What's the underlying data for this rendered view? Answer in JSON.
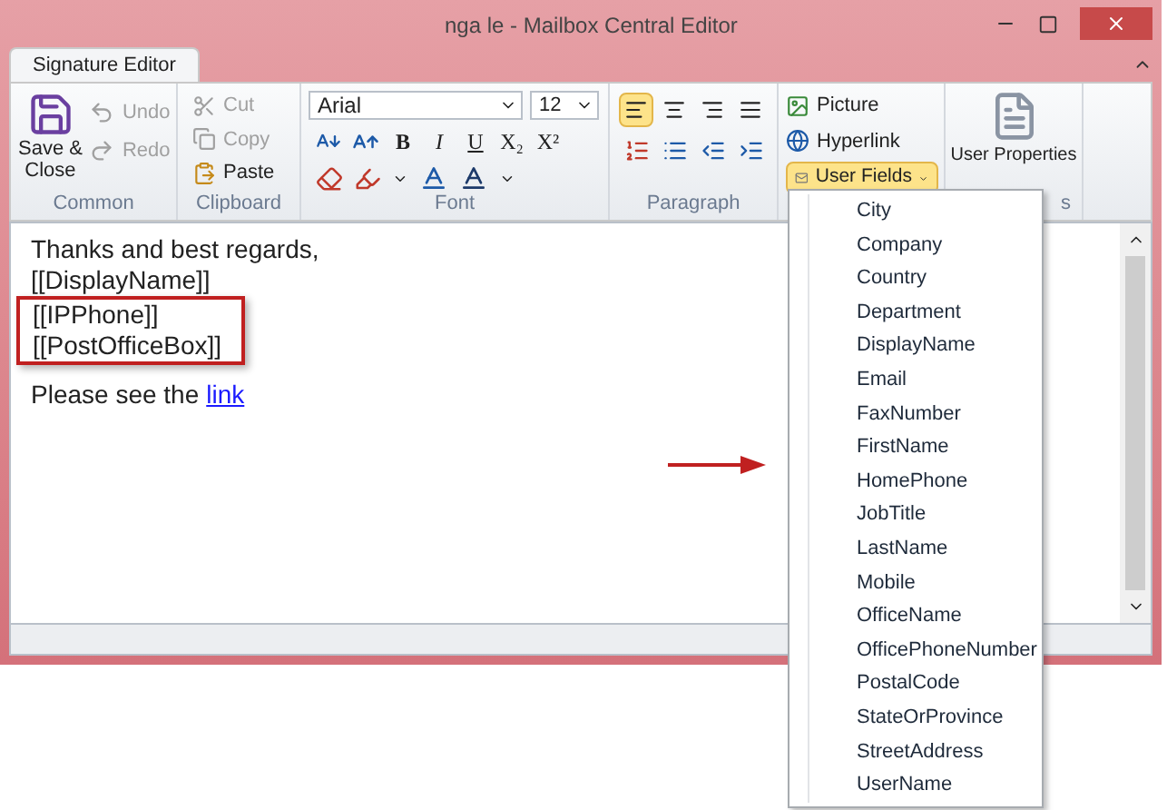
{
  "window": {
    "title": "nga le - Mailbox Central Editor"
  },
  "tabs": [
    {
      "label": "Signature Editor",
      "selected": true
    }
  ],
  "ribbon": {
    "common": {
      "label": "Common",
      "save": "Save &\nClose",
      "buttons": [
        {
          "label": "Undo",
          "disabled": true
        },
        {
          "label": "Redo",
          "disabled": true
        }
      ]
    },
    "clipboard": {
      "label": "Clipboard",
      "buttons": [
        {
          "label": "Cut",
          "disabled": true
        },
        {
          "label": "Copy",
          "disabled": true
        },
        {
          "label": "Paste",
          "disabled": false
        }
      ]
    },
    "font": {
      "label": "Font",
      "family": "Arial",
      "size": "12",
      "format_buttons": [
        "B",
        "I",
        "U",
        "X₂",
        "X²"
      ]
    },
    "paragraph": {
      "label": "Paragraph",
      "align": [
        {
          "selected": true
        },
        {
          "selected": false
        },
        {
          "selected": false
        },
        {
          "selected": false
        }
      ]
    },
    "insert": {
      "buttons": [
        {
          "label": "Picture"
        },
        {
          "label": "Hyperlink"
        }
      ],
      "user_fields": {
        "label": "User Fields",
        "expanded": true
      }
    },
    "properties": {
      "label": "User Properties",
      "group_label": "s"
    }
  },
  "editor": {
    "lines": [
      "Thanks and best regards,",
      "[[DisplayName]]"
    ],
    "highlighted_lines": [
      "[[IPPhone]]",
      "[[PostOfficeBox]]"
    ],
    "link_sentence": "Please see the",
    "link": "link"
  },
  "user_fields_menu": [
    "City",
    "Company",
    "Country",
    "Department",
    "DisplayName",
    "Email",
    "FaxNumber",
    "FirstName",
    "HomePhone",
    "JobTitle",
    "LastName",
    "Mobile",
    "OfficeName",
    "OfficePhoneNumber",
    "PostalCode",
    "StateOrProvince",
    "StreetAddress",
    "UserName"
  ]
}
